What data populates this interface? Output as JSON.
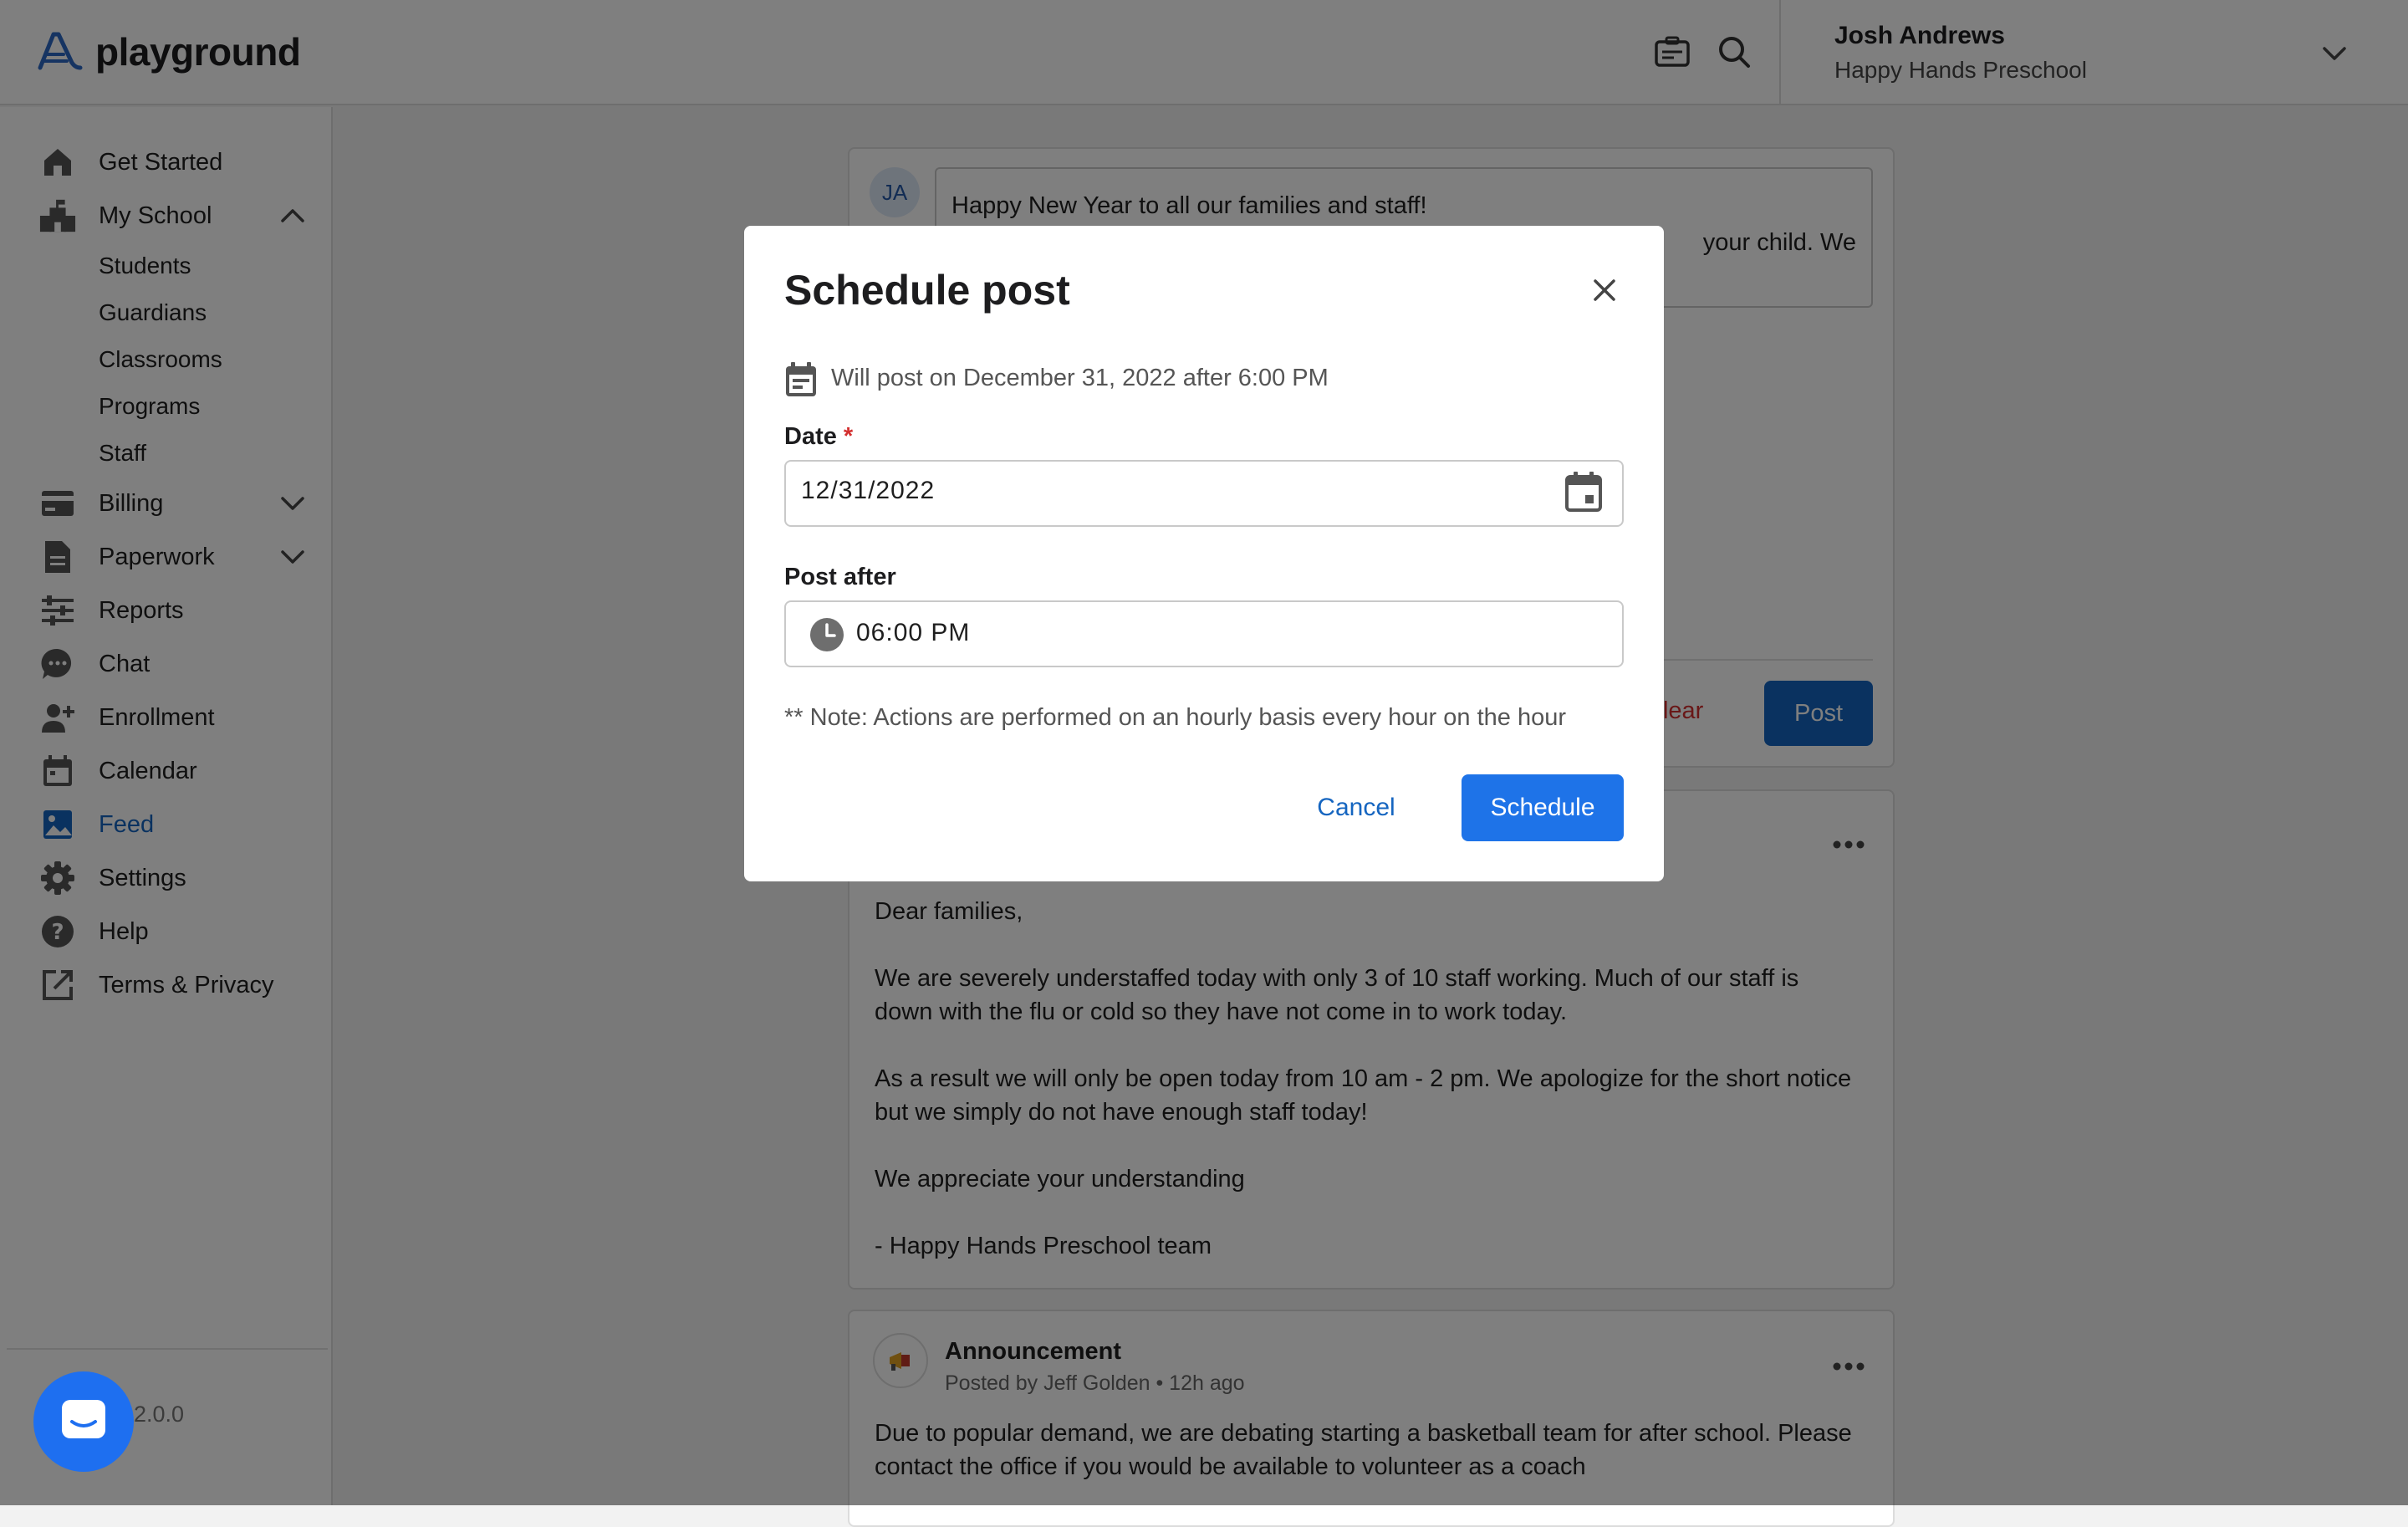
{
  "app": {
    "logo_text": "playground"
  },
  "header": {
    "user_name": "Josh Andrews",
    "school": "Happy Hands Preschool"
  },
  "sidebar": {
    "items": [
      {
        "label": "Get Started",
        "icon": "home-icon"
      },
      {
        "label": "My School",
        "icon": "school-icon"
      },
      {
        "label": "Billing",
        "icon": "credit-card-icon"
      },
      {
        "label": "Paperwork",
        "icon": "document-icon"
      },
      {
        "label": "Reports",
        "icon": "sliders-icon"
      },
      {
        "label": "Chat",
        "icon": "chat-icon"
      },
      {
        "label": "Enrollment",
        "icon": "add-person-icon"
      },
      {
        "label": "Calendar",
        "icon": "calendar-icon"
      },
      {
        "label": "Feed",
        "icon": "image-icon"
      },
      {
        "label": "Settings",
        "icon": "gear-icon"
      },
      {
        "label": "Help",
        "icon": "help-icon"
      },
      {
        "label": "Terms & Privacy",
        "icon": "external-link-icon"
      }
    ],
    "my_school_sub": [
      "Students",
      "Guardians",
      "Classrooms",
      "Programs",
      "Staff"
    ],
    "version": "2.0.0",
    "colors": {
      "active": "#1565c0"
    }
  },
  "composer": {
    "avatar_initials": "JA",
    "text_line1": "Happy New Year to all our families and staff!",
    "text_line2": "your child. We",
    "clear_label": "Clear",
    "post_label": "Post"
  },
  "post": {
    "p1": "Dear families,",
    "p2": "We are severely understaffed today with only 3 of 10 staff working. Much of our staff is down with the flu or cold so they have not come in to work today.",
    "p3": "As a result we will only be open today from 10 am - 2 pm. We apologize for the short notice but we simply do not have enough staff today!",
    "p4": "We appreciate your understanding",
    "p5": "- Happy Hands Preschool team"
  },
  "announcement": {
    "title": "Announcement",
    "meta": "Posted by Jeff Golden • 12h ago",
    "body": "Due to popular demand, we are debating starting a basketball team for after school. Please contact the office if you would be available to volunteer as a coach"
  },
  "modal": {
    "title": "Schedule post",
    "will_post": "Will post on December 31, 2022 after 6:00 PM",
    "date_label": "Date",
    "required_mark": "*",
    "date_value": "12/31/2022",
    "post_after_label": "Post after",
    "time_value": "06:00 PM",
    "note": "** Note: Actions are performed on an hourly basis every hour on the hour",
    "cancel_label": "Cancel",
    "schedule_label": "Schedule",
    "colors": {
      "primary": "#1e73e8",
      "required": "#d32f2f"
    }
  }
}
